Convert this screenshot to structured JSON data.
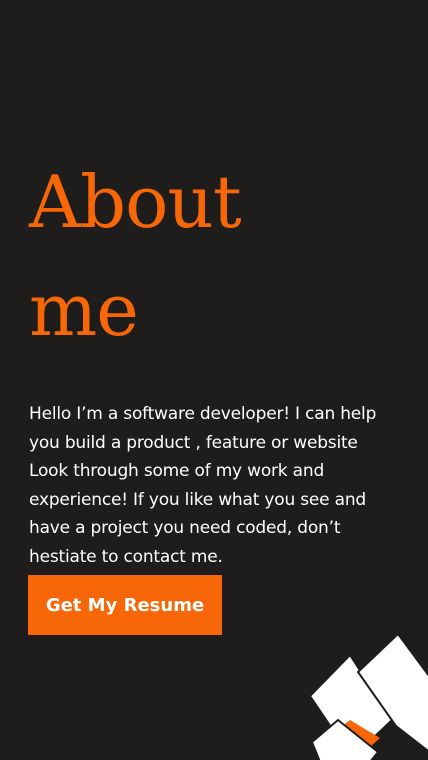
{
  "about": {
    "heading_line1": "About",
    "heading_line2": "me",
    "bio": "Hello I’m a software developer! I can help you build a product , feature or website Look through some of my work and experience! If you like what you see and have a project you need coded, don’t hestiate to contact me."
  },
  "actions": {
    "resume_label": "Get My Resume"
  },
  "colors": {
    "background": "#1e1d1c",
    "accent": "#f76707",
    "text": "#ffffff"
  }
}
